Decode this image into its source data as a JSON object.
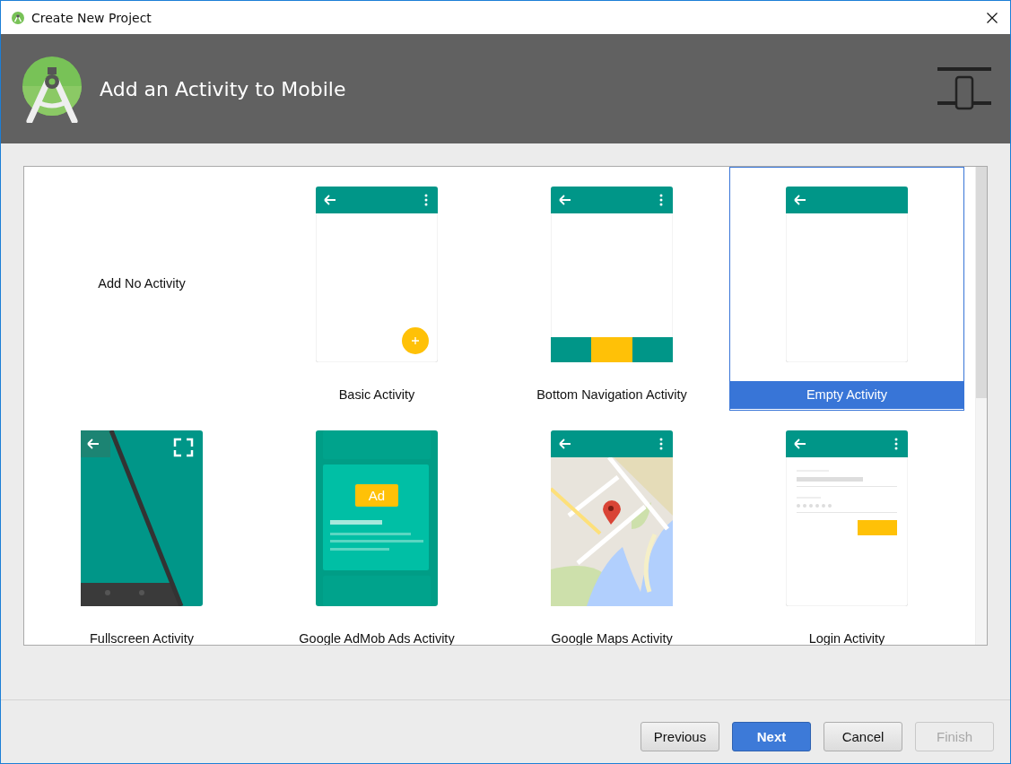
{
  "window": {
    "title": "Create New Project"
  },
  "header": {
    "title": "Add an Activity to Mobile"
  },
  "activities": [
    {
      "kind": "none",
      "label": "Add No Activity",
      "selected": false
    },
    {
      "kind": "basic",
      "label": "Basic Activity",
      "selected": false
    },
    {
      "kind": "bottomnav",
      "label": "Bottom Navigation Activity",
      "selected": false
    },
    {
      "kind": "empty",
      "label": "Empty Activity",
      "selected": true
    },
    {
      "kind": "fullscreen",
      "label": "Fullscreen Activity",
      "selected": false
    },
    {
      "kind": "admob",
      "label": "Google AdMob Ads Activity",
      "selected": false,
      "ad_label": "Ad"
    },
    {
      "kind": "maps",
      "label": "Google Maps Activity",
      "selected": false
    },
    {
      "kind": "login",
      "label": "Login Activity",
      "selected": false
    }
  ],
  "buttons": [
    {
      "label": "Previous",
      "kind": "default",
      "disabled": false
    },
    {
      "label": "Next",
      "kind": "primary",
      "disabled": false
    },
    {
      "label": "Cancel",
      "kind": "default",
      "disabled": false
    },
    {
      "label": "Finish",
      "kind": "default",
      "disabled": true
    }
  ]
}
